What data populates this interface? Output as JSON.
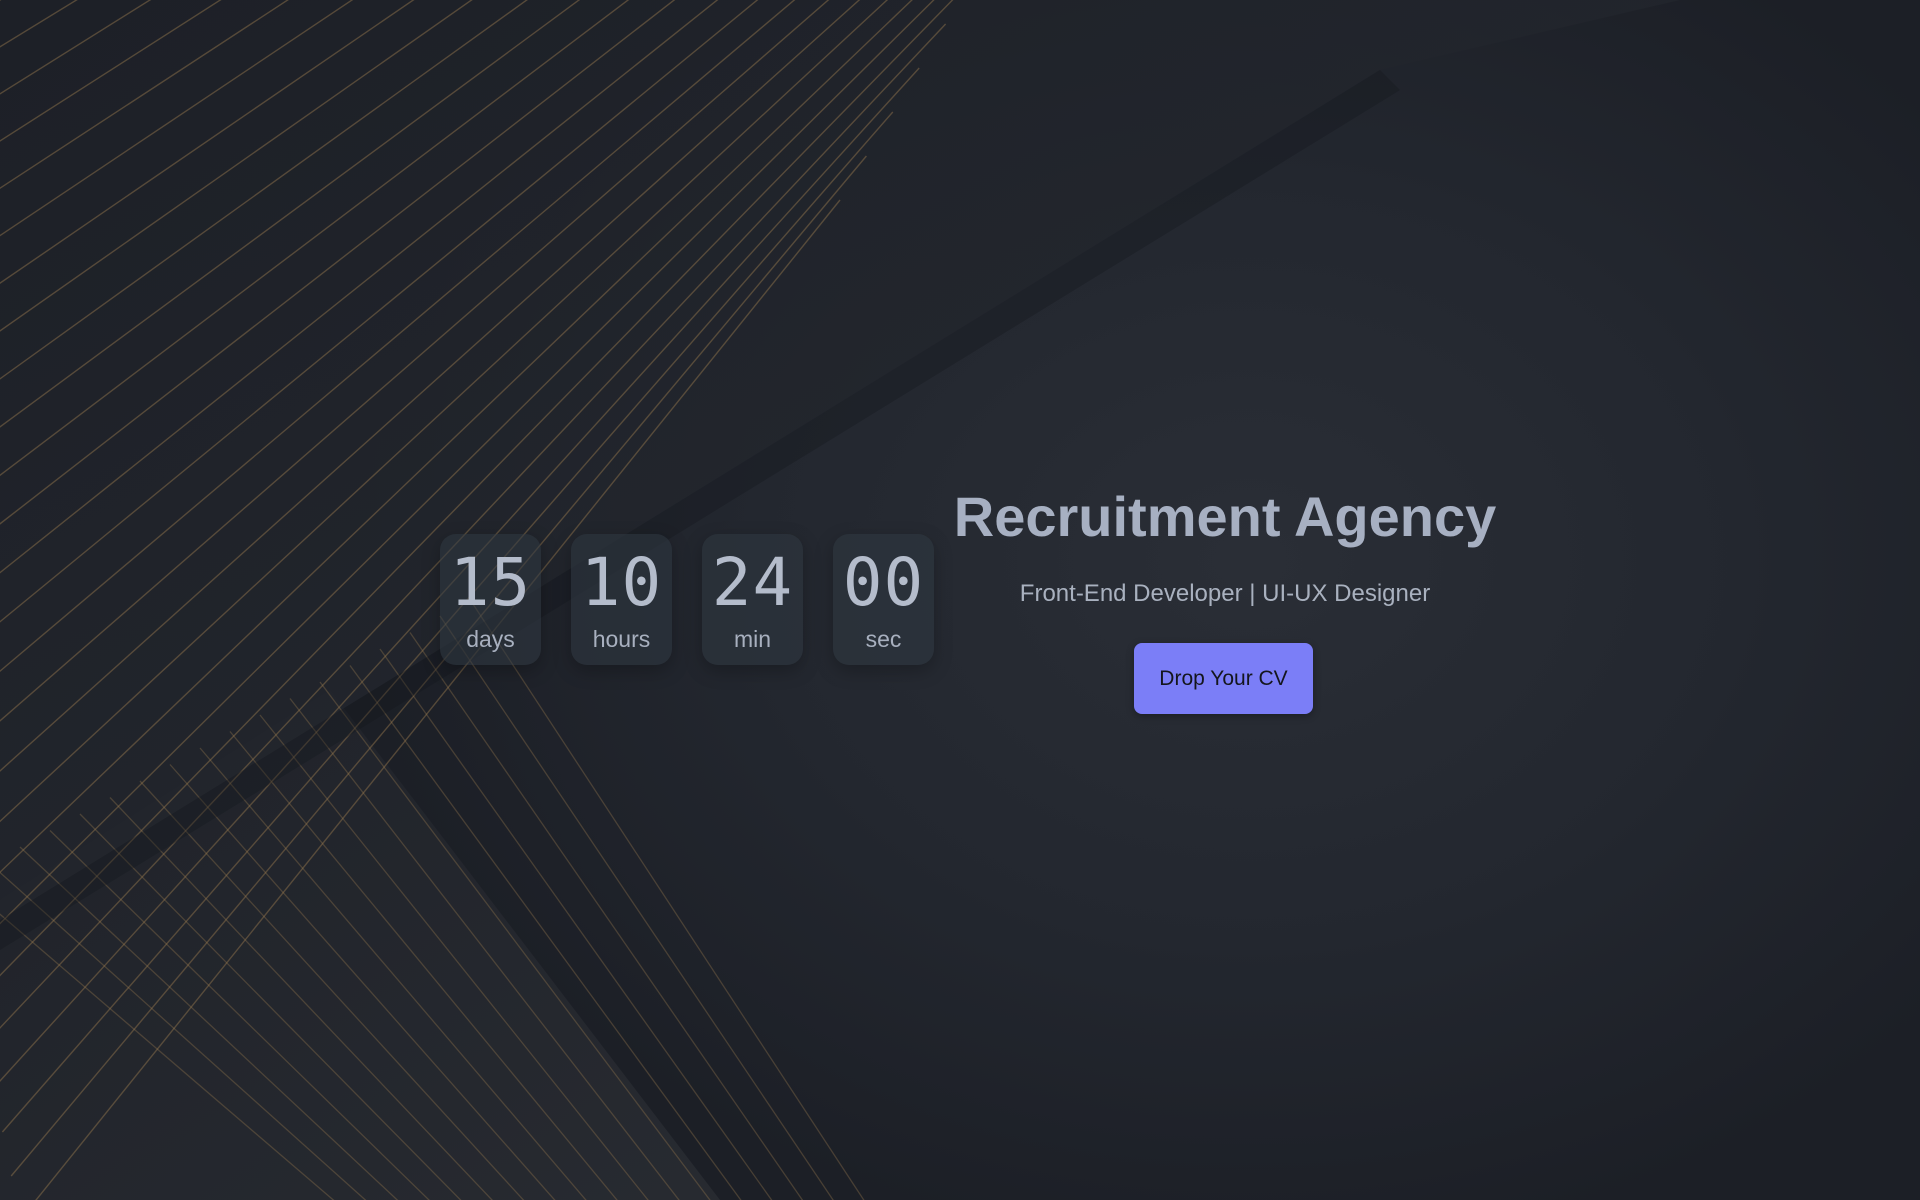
{
  "countdown": [
    {
      "value": "15",
      "unit": "days"
    },
    {
      "value": "10",
      "unit": "hours"
    },
    {
      "value": "24",
      "unit": "min"
    },
    {
      "value": "00",
      "unit": "sec"
    }
  ],
  "hero": {
    "title": "Recruitment Agency",
    "subtitle": "Front-End Developer | UI-UX Designer",
    "cta_label": "Drop Your CV"
  },
  "colors": {
    "background": "#22262e",
    "accent": "#7b7ef7",
    "text": "#a7b0c2",
    "stripe": "#9a7b4f"
  }
}
